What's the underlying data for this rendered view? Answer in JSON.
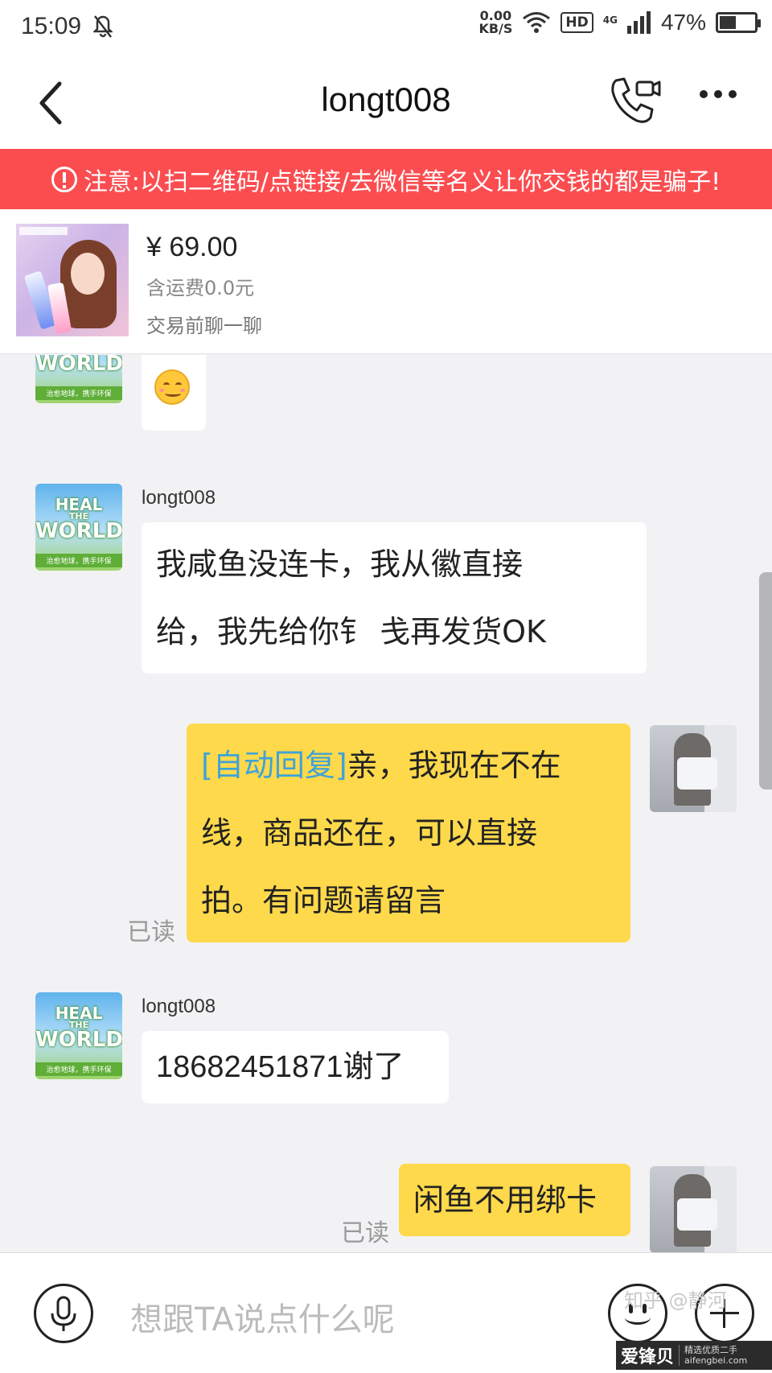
{
  "status_bar": {
    "time": "15:09",
    "net_speed_value": "0.00",
    "net_speed_unit": "KB/S",
    "hd": "HD",
    "network": "4G",
    "battery_percent": "47%",
    "battery_level": 0.47
  },
  "header": {
    "title": "longt008"
  },
  "warning_banner": {
    "text": "注意:以扫二维码/点链接/去微信等名义让你交钱的都是骗子!"
  },
  "product": {
    "price": "¥ 69.00",
    "shipping": "含运费0.0元",
    "chat_prompt": "交易前聊一聊"
  },
  "avatar_text": {
    "line1": "HEAL",
    "line2": "THE",
    "line3": "WORLD",
    "sub": "治愈地球，携手环保"
  },
  "messages": [
    {
      "sender": "longt008",
      "text_line1": "我咸鱼没连卡，我从徽直接",
      "text_line2": "给，我先给你钅 戋再发货OK"
    },
    {
      "sender": "me",
      "tag": "[自动回复]",
      "text_line1": "亲，我现在不在",
      "text_line2": "线，商品还在，可以直接",
      "text_line3": "拍。有问题请留言",
      "status": "已读"
    },
    {
      "sender": "longt008",
      "text": "18682451871谢了"
    },
    {
      "sender": "me",
      "text": "闲鱼不用绑卡",
      "status": "已读"
    }
  ],
  "input": {
    "placeholder": "想跟TA说点什么呢"
  },
  "watermark": {
    "text": "知乎 @静河",
    "logo": "爱锋贝",
    "logo_sub1": "精选优质二手",
    "logo_sub2": "aifengbei.com"
  }
}
